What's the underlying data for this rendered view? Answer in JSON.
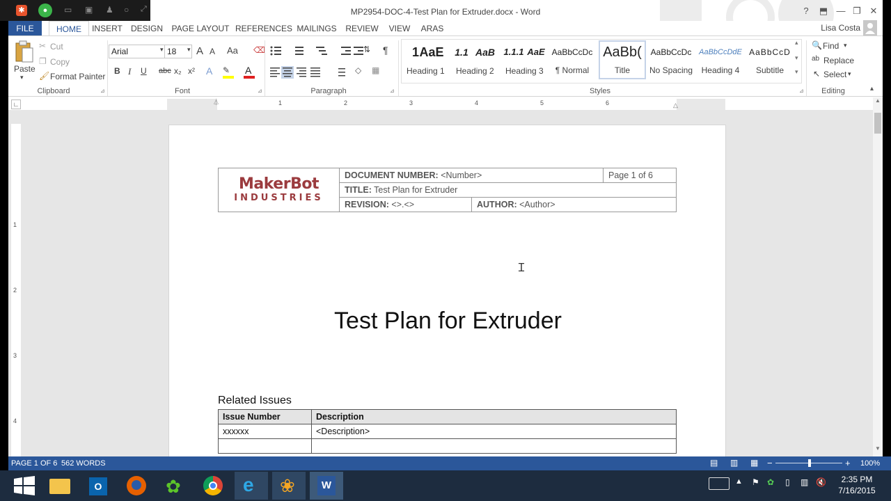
{
  "window": {
    "title": "MP2954-DOC-4-Test Plan for Extruder.docx - Word"
  },
  "title_controls": {
    "help": "?",
    "minimize": "—",
    "restore": "❐",
    "close": "✕"
  },
  "tabs": [
    "FILE",
    "HOME",
    "INSERT",
    "DESIGN",
    "PAGE LAYOUT",
    "REFERENCES",
    "MAILINGS",
    "REVIEW",
    "VIEW",
    "ARAS"
  ],
  "user": {
    "name": "Lisa Costa"
  },
  "clipboard": {
    "paste": "Paste",
    "cut": "Cut",
    "copy": "Copy",
    "format_painter": "Format Painter",
    "label": "Clipboard"
  },
  "font": {
    "family": "Arial",
    "size": "18",
    "label": "Font",
    "bold": "B",
    "italic": "I",
    "underline": "U",
    "strike": "abc",
    "sub": "x₂",
    "sup": "x²",
    "grow": "A",
    "shrink": "A",
    "case": "Aa"
  },
  "paragraph": {
    "label": "Paragraph",
    "pilcrow": "¶"
  },
  "styles": {
    "label": "Styles",
    "items": [
      {
        "sample": "1",
        "name": "Heading 1"
      },
      {
        "sample": "AaE",
        "name": ""
      },
      {
        "sample": "1.1",
        "name": "Heading 2"
      },
      {
        "sample": "AaB",
        "name": ""
      },
      {
        "sample": "1.1.1",
        "name": "Heading 3"
      },
      {
        "sample": "AaE",
        "name": ""
      },
      {
        "sample": "AaBbCcDc",
        "name": "¶ Normal"
      },
      {
        "sample": "AaBb(",
        "name": "Title"
      },
      {
        "sample": "AaBbCcDc",
        "name": "No Spacing"
      },
      {
        "sample": "AaBbCcDdE",
        "name": "Heading 4"
      },
      {
        "sample": "AaBbCcD",
        "name": "Subtitle"
      }
    ]
  },
  "editing": {
    "label": "Editing",
    "find": "Find",
    "replace": "Replace",
    "select": "Select"
  },
  "ruler": {
    "numbers": [
      "1",
      "2",
      "3",
      "4",
      "5",
      "6"
    ],
    "vnumbers": [
      "1",
      "2",
      "3",
      "4"
    ]
  },
  "document": {
    "logo_top": "MakerBot",
    "logo_bottom": "INDUSTRIES",
    "doc_number_label": "DOCUMENT NUMBER:",
    "doc_number_value": "<Number>",
    "page_of": "Page 1 of 6",
    "title_label": "TITLE:",
    "title_value": "Test Plan for Extruder",
    "revision_label": "REVISION:",
    "revision_value": "<>.<>",
    "author_label": "AUTHOR:",
    "author_value": "<Author>",
    "main_title": "Test Plan for Extruder",
    "related_heading": "Related Issues",
    "table_headers": [
      "Issue Number",
      "Description"
    ],
    "table_rows": [
      [
        "xxxxxx",
        "<Description>"
      ],
      [
        "",
        ""
      ]
    ]
  },
  "status": {
    "page": "PAGE 1 OF 6",
    "words": "562 WORDS",
    "zoom": "100%"
  },
  "taskbar": {
    "time": "2:35 PM",
    "date": "7/16/2015"
  },
  "colors": {
    "accent": "#2b579a",
    "taskbar": "#1d2c3f",
    "logo": "#9b3b3e"
  }
}
